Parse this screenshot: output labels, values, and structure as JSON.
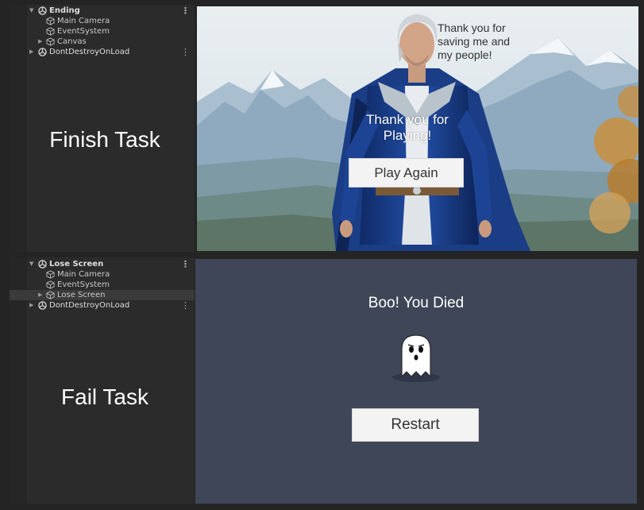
{
  "top": {
    "hierarchy": {
      "scene": "Ending",
      "children": [
        "Main Camera",
        "EventSystem",
        "Canvas"
      ],
      "dont_destroy": "DontDestroyOnLoad"
    },
    "task_label": "Finish Task",
    "game": {
      "speech": [
        "Thank you for",
        "saving me and",
        "my people!"
      ],
      "thanks": [
        "Thank you for",
        "Playing!"
      ],
      "button_label": "Play Again"
    }
  },
  "bottom": {
    "hierarchy": {
      "scene": "Lose Screen",
      "children": [
        "Main Camera",
        "EventSystem",
        "Lose Screen"
      ],
      "dont_destroy": "DontDestroyOnLoad"
    },
    "task_label": "Fail Task",
    "game": {
      "message": "Boo! You Died",
      "button_label": "Restart",
      "background_color": "#3f4657"
    }
  },
  "icons": {
    "scene": "unity-scene-icon",
    "gameobject": "gameobject-cube-icon",
    "menu": "kebab-menu-icon",
    "expand": "expand-arrow-icon",
    "collapse": "collapse-arrow-icon"
  }
}
